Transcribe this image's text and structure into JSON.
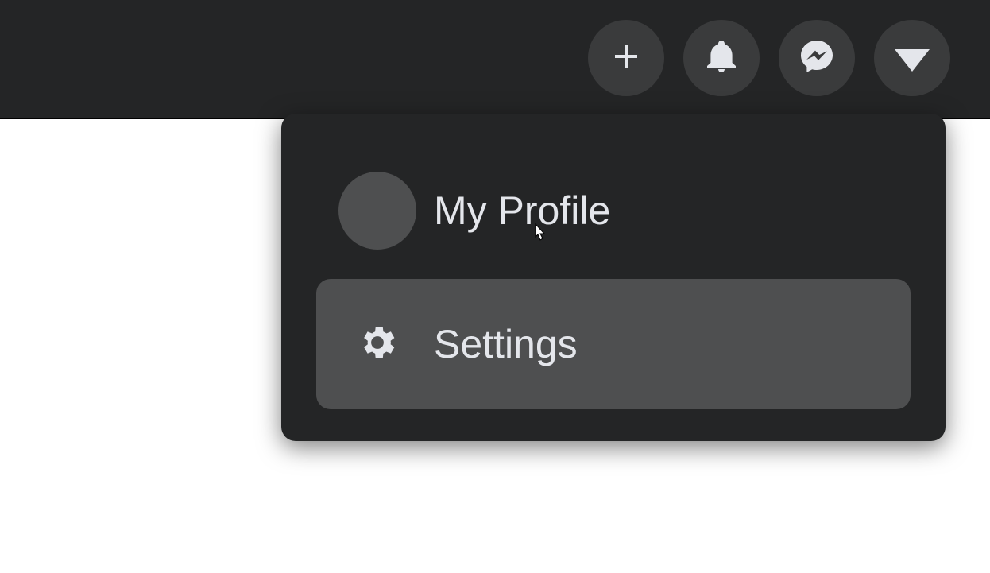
{
  "nav": {
    "create": "create",
    "notifications": "notifications",
    "messenger": "messenger",
    "account": "account"
  },
  "dropdown": {
    "profile_label": "My Profile",
    "settings_label": "Settings"
  }
}
